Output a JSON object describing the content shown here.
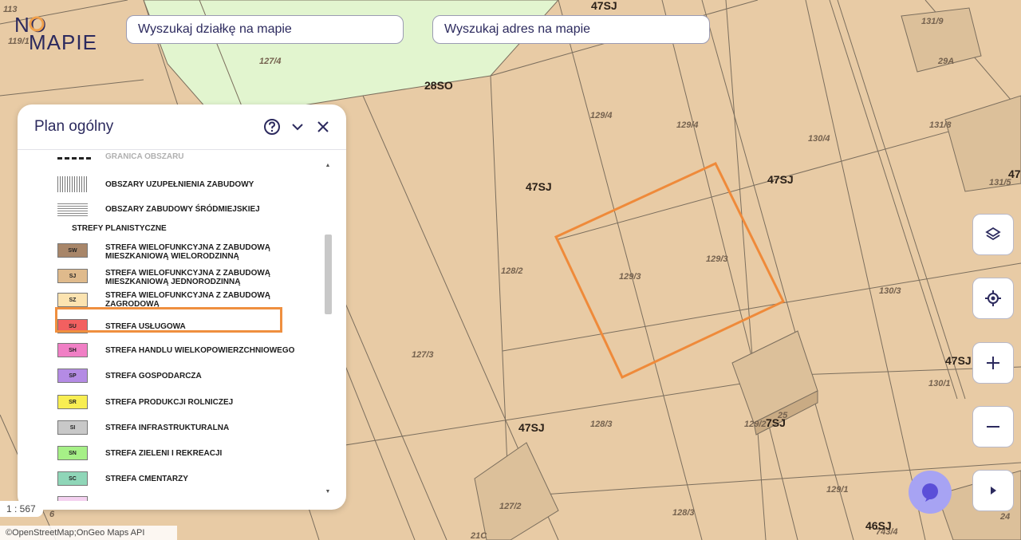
{
  "logo": {
    "line1": "NO",
    "line2": "MAPIE",
    "accent": "#f0a04b"
  },
  "search": {
    "parcel_placeholder": "Wyszukaj działkę na mapie",
    "address_placeholder": "Wyszukaj adres na mapie"
  },
  "map": {
    "parcel_labels": [
      "113",
      "119/1",
      "127/4",
      "129/4",
      "129/4",
      "130/4",
      "131/9",
      "29A",
      "131/8",
      "131/5",
      "128/2",
      "129/3",
      "129/3",
      "130/3",
      "127/3",
      "130/1",
      "128/3",
      "129/2",
      "25",
      "127/2",
      "128/3",
      "129/1",
      "743/4",
      "21C",
      "24",
      "6"
    ],
    "zone_labels": [
      "47SJ",
      "28SO",
      "47SJ",
      "47SJ",
      "47SJ",
      "47SJ",
      "47",
      "7SJ",
      "46SJ"
    ],
    "selected_parcel_color": "#ef8a3a"
  },
  "panel": {
    "title": "Plan ogólny",
    "help_icon": "help-circle-icon",
    "collapse_icon": "chevron-down-icon",
    "close_icon": "close-icon",
    "legend": {
      "cut_item": "GRANICA OBSZARU",
      "fill_item": "OBSZARY UZUPEŁNIENIA ZABUDOWY",
      "urban_item": "OBSZARY ZABUDOWY ŚRÓDMIEJSKIEJ",
      "section": "STREFY PLANISTYCZNE",
      "zones": [
        {
          "code": "SW",
          "label": "STREFA WIELOFUNKCYJNA Z ZABUDOWĄ MIESZKANIOWĄ WIELORODZINNĄ",
          "color": "#a88669"
        },
        {
          "code": "SJ",
          "label": "STREFA WIELOFUNKCYJNA Z ZABUDOWĄ MIESZKANIOWĄ JEDNORODZINNĄ",
          "color": "#dfba8c"
        },
        {
          "code": "SZ",
          "label": "STREFA WIELOFUNKCYJNA Z ZABUDOWĄ ZAGRODOWĄ",
          "color": "#fbe3b0"
        },
        {
          "code": "SU",
          "label": "STREFA USŁUGOWA",
          "color": "#f26060"
        },
        {
          "code": "SH",
          "label": "STREFA HANDLU WIELKOPOWIERZCHNIOWEGO",
          "color": "#f07fc5"
        },
        {
          "code": "SP",
          "label": "STREFA GOSPODARCZA",
          "color": "#b48be4"
        },
        {
          "code": "SR",
          "label": "STREFA PRODUKCJI ROLNICZEJ",
          "color": "#f8ee52"
        },
        {
          "code": "SI",
          "label": "STREFA INFRASTRUKTURALNA",
          "color": "#c8c8c8"
        },
        {
          "code": "SN",
          "label": "STREFA ZIELENI I REKREACJI",
          "color": "#a6f087"
        },
        {
          "code": "SC",
          "label": "STREFA CMENTARZY",
          "color": "#8fd6b8"
        }
      ],
      "highlighted_code": "SJ",
      "highlight_color": "#ef8f3f"
    }
  },
  "controls": {
    "layers_icon": "layers-icon",
    "locate_icon": "locate-icon",
    "zoom_in_icon": "plus-icon",
    "zoom_out_icon": "minus-icon",
    "expand_icon": "play-icon",
    "chat_icon": "chat-icon"
  },
  "scale": "1 : 567",
  "attribution": "©OpenStreetMap;OnGeo Maps API"
}
